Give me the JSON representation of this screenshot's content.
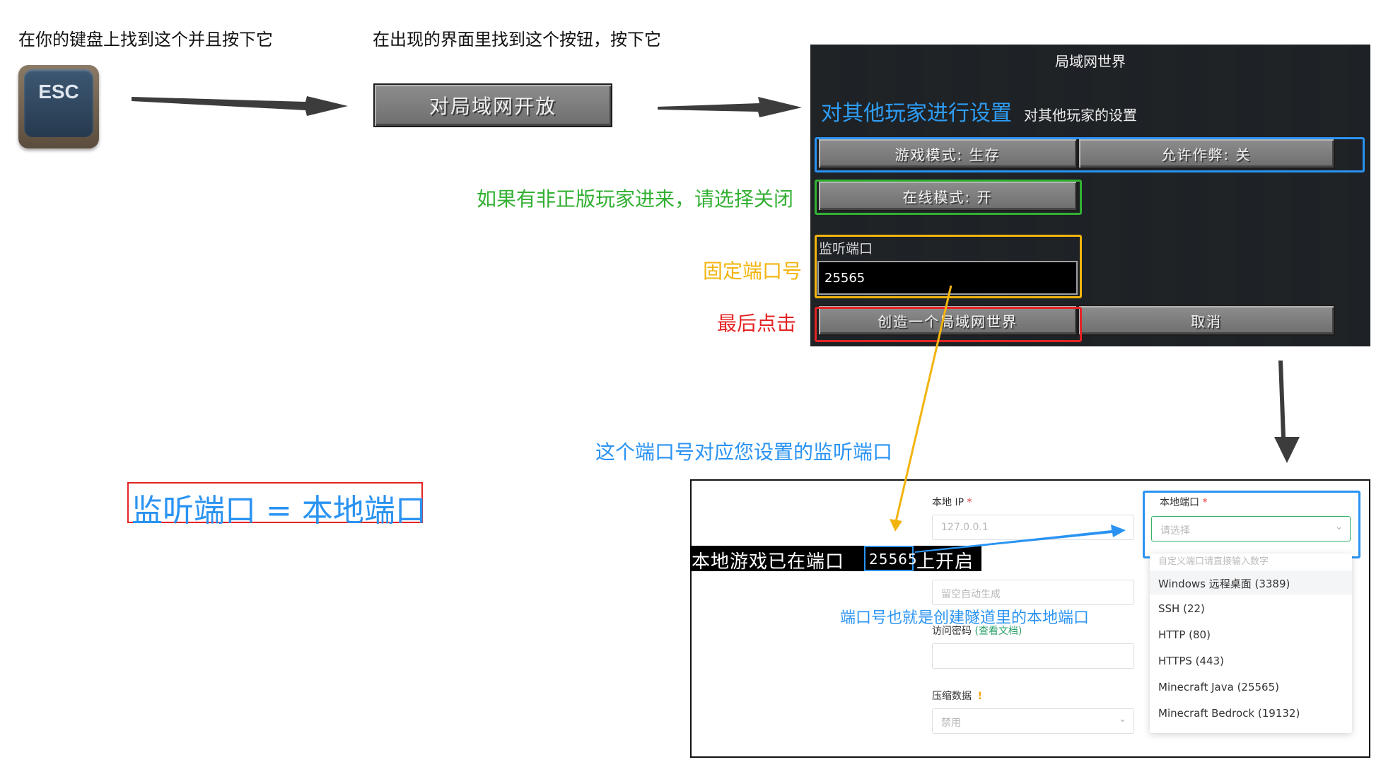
{
  "steps": {
    "step1_text": "在你的键盘上找到这个并且按下它",
    "step2_text": "在出现的界面里找到这个按钮，按下它"
  },
  "esc_key": {
    "label": "ESC"
  },
  "open_lan_button": {
    "label": "对局域网开放"
  },
  "lan_world": {
    "title": "局域网世界",
    "section_title": "对其他玩家进行设置",
    "section_subtitle": "对其他玩家的设置",
    "game_mode_button": "游戏模式: 生存",
    "allow_cheats_button": "允许作弊: 关",
    "online_mode_button": "在线模式: 开",
    "port_label": "监听端口",
    "port_value": "25565",
    "create_button": "创造一个局域网世界",
    "cancel_button": "取消"
  },
  "annotations": {
    "online_mode_note": "如果有非正版玩家进来，请选择关闭",
    "fixed_port_note": "固定端口号",
    "final_click_note": "最后点击",
    "port_correspond_note": "这个端口号对应您设置的监听端口",
    "tunnel_port_note": "端口号也就是创建隧道里的本地端口",
    "equation": "监听端口 = 本地端口"
  },
  "game_message": {
    "prefix": "本地游戏已在端口",
    "port": "25565",
    "suffix": "上开启"
  },
  "tunnel_form": {
    "local_ip_label": "本地 IP",
    "required_mark": "*",
    "local_ip_value": "127.0.0.1",
    "remote_port_placeholder": "留空自动生成",
    "password_label": "访问密码",
    "docs_link": "(查看文档)",
    "compress_label": "压缩数据",
    "warning_mark": "!",
    "compress_value": "禁用",
    "local_port_label": "本地端口",
    "local_port_placeholder": "请选择",
    "dropdown_hint": "自定义端口请直接输入数字",
    "dropdown_options": [
      "Windows 远程桌面 (3389)",
      "SSH (22)",
      "HTTP (80)",
      "HTTPS (443)",
      "Minecraft Java (25565)",
      "Minecraft Bedrock (19132)"
    ]
  },
  "colors": {
    "blue": "#2a93f2",
    "green": "#33b033",
    "yellow": "#f2b40f",
    "red": "#e32424",
    "arrow_gray": "#3c3c3c"
  }
}
